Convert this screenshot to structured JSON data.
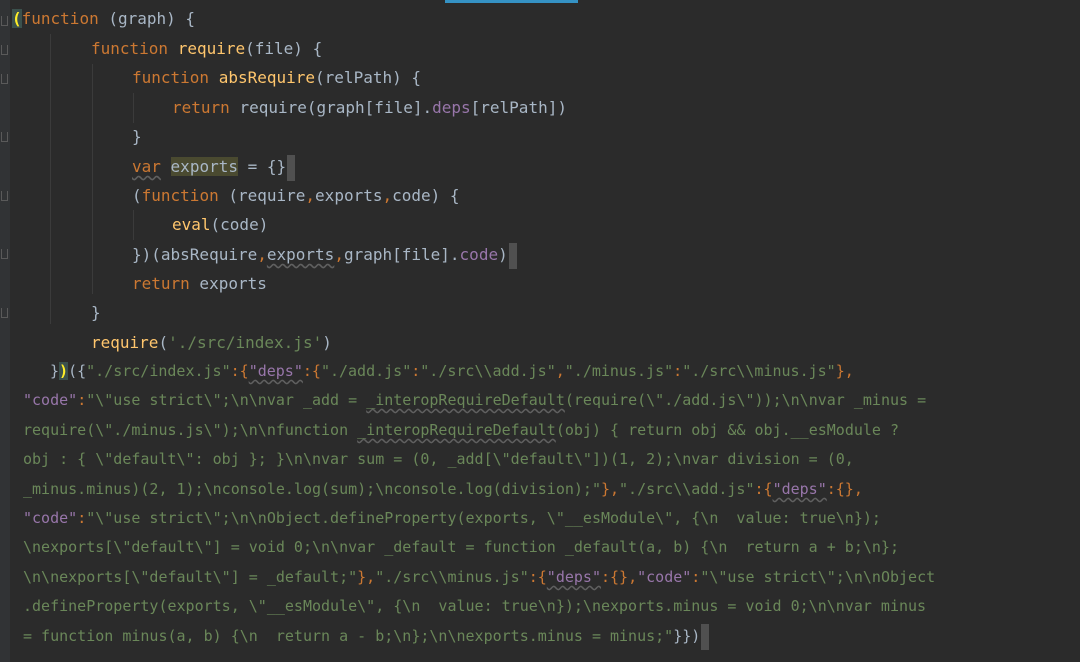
{
  "code": {
    "l1": {
      "a": "(",
      "b": "function",
      "c": " (graph) {"
    },
    "l2": {
      "a": "function",
      "b": "require",
      "c": "(file) {"
    },
    "l3": {
      "a": "function",
      "b": "absRequire",
      "c": "(relPath) {"
    },
    "l4": {
      "a": "return",
      "b": "require",
      "c": "(graph[file].",
      "d": "deps",
      "e": "[relPath])"
    },
    "l5": {
      "a": "}"
    },
    "l6": {
      "a": "var",
      "b": " ",
      "c": "exports",
      "d": " = {}"
    },
    "l7": {
      "a": "(",
      "b": "function",
      "c": " (require",
      "d": ",",
      "e": "exports",
      "f": ",",
      "g": "code) {"
    },
    "l8": {
      "a": "eval",
      "b": "(code)"
    },
    "l9": {
      "a": "})(absRequire",
      "b": ",",
      "c": "exports",
      "d": ",",
      "e": "graph[file].",
      "f": "code",
      ")": ")"
    },
    "l10": {
      "a": "return",
      "b": " exports"
    },
    "l11": {
      "a": "}"
    },
    "l12": {
      "a": "require",
      "b": "(",
      "c": "'./src/index.js'",
      "d": ")"
    },
    "l13": {
      "a": "}",
      "b": ")",
      "c": "({",
      "d": "\"./src/index.js\"",
      "e": ":{",
      "f": "\"deps\"",
      "g": ":{",
      "h": "\"./add.js\"",
      "i": ":",
      "j": "\"./src\\\\add.js\"",
      "k": ",",
      "l": "\"./minus.js\"",
      "m": ":",
      "n": "\"./src\\\\minus.js\"",
      "o": "},"
    },
    "l14": {
      "a": "\"code\"",
      "b": ":",
      "c": "\"\\\"use strict\\\";\\n\\nvar _add = ",
      "d": "_interopRequireDefault",
      "e": "(require(\\\"./add.js\\\"));\\n\\nvar _minus ="
    },
    "l15": {
      "a": "require(\\\"./minus.js\\\");\\n\\nfunction ",
      "b": "_interopRequireDefault",
      "c": "(obj) { return obj && obj.__esModule ?"
    },
    "l16": {
      "a": "obj : { \\\"default\\\": obj }; }\\n\\nvar sum = (0, _add[\\\"default\\\"])(1, 2);\\nvar division = (0,"
    },
    "l17": {
      "a": "_minus.minus)(2, 1);\\nconsole.log(sum);\\nconsole.log(division);\"",
      "b": "},",
      "c": "\"./src\\\\add.js\"",
      "d": ":{",
      "e": "\"deps\"",
      "f": ":{},"
    },
    "l18": {
      "a": "\"code\"",
      "b": ":",
      "c": "\"\\\"use strict\\\";\\n\\nObject.defineProperty(exports, \\\"__esModule\\\", {\\n  value: true\\n});"
    },
    "l19": {
      "a": "\\nexports[\\\"default\\\"] = void 0;\\n\\nvar _default = function _default(a, b) {\\n  return a + b;\\n};"
    },
    "l20": {
      "a": "\\n\\nexports[\\\"default\\\"] = _default;\"",
      "b": "},",
      "c": "\"./src\\\\minus.js\"",
      "d": ":{",
      "e": "\"deps\"",
      "f": ":{},",
      "g": "\"code\"",
      "h": ":",
      "i": "\"\\\"use strict\\\";\\n\\nObject"
    },
    "l21": {
      "a": ".defineProperty(exports, \\\"__esModule\\\", {\\n  value: true\\n});\\nexports.minus = void 0;\\n\\nvar minus"
    },
    "l22": {
      "a": "= function minus(a, b) {\\n  return a - b;\\n};\\n\\nexports.minus = minus;\"",
      "b": "}})"
    }
  },
  "colors": {
    "background": "#2b2b2b",
    "keyword": "#cc7832",
    "function": "#ffc66d",
    "string": "#6a8759",
    "property": "#9876aa",
    "text": "#a9b7c6"
  }
}
